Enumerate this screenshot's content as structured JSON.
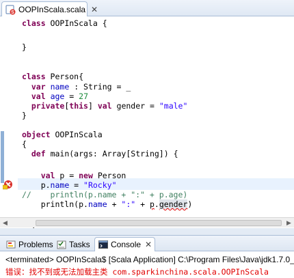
{
  "editor": {
    "tab_label": "OOPInScala.scala",
    "close_glyph": "✕",
    "lines": [
      {
        "segments": [
          {
            "t": "class",
            "c": "kw"
          },
          {
            "t": " OOPInScala {",
            "c": ""
          }
        ]
      },
      {
        "segments": [
          {
            "t": "",
            "c": ""
          }
        ]
      },
      {
        "segments": [
          {
            "t": "}",
            "c": ""
          }
        ]
      },
      {
        "segments": [
          {
            "t": "",
            "c": ""
          }
        ]
      },
      {
        "segments": [
          {
            "t": "class",
            "c": "kw"
          },
          {
            "t": " Person{",
            "c": ""
          }
        ]
      },
      {
        "segments": [
          {
            "t": "  ",
            "c": ""
          },
          {
            "t": "var",
            "c": "kw"
          },
          {
            "t": " ",
            "c": ""
          },
          {
            "t": "name",
            "c": "field"
          },
          {
            "t": " : String = _",
            "c": ""
          }
        ]
      },
      {
        "segments": [
          {
            "t": "  ",
            "c": ""
          },
          {
            "t": "val",
            "c": "kw"
          },
          {
            "t": " ",
            "c": ""
          },
          {
            "t": "age",
            "c": "field"
          },
          {
            "t": " = ",
            "c": ""
          },
          {
            "t": "27",
            "c": "num"
          }
        ]
      },
      {
        "segments": [
          {
            "t": "  ",
            "c": ""
          },
          {
            "t": "private",
            "c": "kw"
          },
          {
            "t": "[",
            "c": ""
          },
          {
            "t": "this",
            "c": "kw"
          },
          {
            "t": "] ",
            "c": ""
          },
          {
            "t": "val",
            "c": "kw"
          },
          {
            "t": " gender = ",
            "c": ""
          },
          {
            "t": "\"male\"",
            "c": "str"
          }
        ]
      },
      {
        "segments": [
          {
            "t": "}",
            "c": ""
          }
        ]
      },
      {
        "segments": [
          {
            "t": "",
            "c": ""
          }
        ]
      },
      {
        "segments": [
          {
            "t": "object",
            "c": "kw"
          },
          {
            "t": " OOPInScala",
            "c": ""
          }
        ]
      },
      {
        "segments": [
          {
            "t": "{",
            "c": ""
          }
        ]
      },
      {
        "segments": [
          {
            "t": "  ",
            "c": ""
          },
          {
            "t": "def",
            "c": "kw"
          },
          {
            "t": " main(args: Array[String]) {",
            "c": ""
          }
        ]
      },
      {
        "segments": [
          {
            "t": "",
            "c": ""
          }
        ]
      },
      {
        "segments": [
          {
            "t": "    ",
            "c": ""
          },
          {
            "t": "val",
            "c": "kw"
          },
          {
            "t": " p = ",
            "c": ""
          },
          {
            "t": "new",
            "c": "kw"
          },
          {
            "t": " Person",
            "c": ""
          }
        ]
      },
      {
        "segments": [
          {
            "t": "    p.",
            "c": ""
          },
          {
            "t": "name",
            "c": "field"
          },
          {
            "t": " = ",
            "c": ""
          },
          {
            "t": "\"Rocky\"",
            "c": "str"
          }
        ]
      },
      {
        "segments": [
          {
            "t": "//    println(p.name + \":\" + p.age)",
            "c": "cmt"
          }
        ]
      },
      {
        "segments": [
          {
            "t": "    println(p.",
            "c": ""
          },
          {
            "t": "name",
            "c": "field"
          },
          {
            "t": " + ",
            "c": ""
          },
          {
            "t": "\":\"",
            "c": "str"
          },
          {
            "t": " + ",
            "c": ""
          },
          {
            "t": "p",
            "c": "err"
          },
          {
            "t": ".",
            "c": ""
          },
          {
            "t": "gender",
            "c": "err hl-bg"
          },
          {
            "t": ")",
            "c": ""
          }
        ]
      },
      {
        "segments": [
          {
            "t": "",
            "c": ""
          }
        ]
      },
      {
        "segments": [
          {
            "t": "  }",
            "c": ""
          }
        ]
      }
    ]
  },
  "panel": {
    "tabs": [
      {
        "label": "Problems",
        "icon": "problems-icon"
      },
      {
        "label": "Tasks",
        "icon": "tasks-icon"
      },
      {
        "label": "Console",
        "icon": "console-icon"
      }
    ],
    "close_glyph": "✕",
    "status_line": "<terminated> OOPInScala$ [Scala Application] C:\\Program Files\\Java\\jdk1.7.0_(",
    "error_prefix": "错误：",
    "error_text": "找不到或无法加载主类 com.sparkinchina.scala.OOPInScala"
  },
  "colors": {
    "keyword": "#7f0055",
    "string": "#2a00ff",
    "number": "#1a8a3a",
    "comment": "#3f7f5f",
    "error": "#e00000",
    "accent": "#a9bcd6"
  }
}
